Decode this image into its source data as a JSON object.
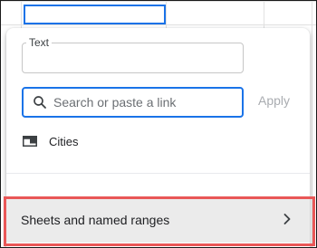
{
  "link_editor": {
    "text_field": {
      "label": "Text",
      "value": ""
    },
    "search_field": {
      "placeholder": "Search or paste a link",
      "value": ""
    },
    "apply_label": "Apply",
    "suggestions": [
      {
        "icon": "sheet-tab-icon",
        "label": "Cities"
      }
    ],
    "sheets_and_ranges": {
      "label": "Sheets and named ranges",
      "icon": "chevron-right-icon"
    }
  },
  "colors": {
    "accent": "#1a73e8",
    "highlight": "#e95757",
    "row_background": "#ebebeb",
    "apply_disabled": "#a9acb0"
  }
}
